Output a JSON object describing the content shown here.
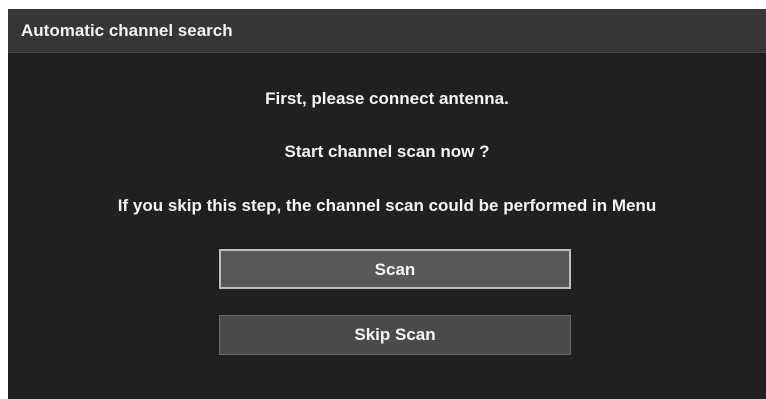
{
  "dialog": {
    "title": "Automatic channel search",
    "messages": [
      "First, please connect antenna.",
      "Start channel scan now ?",
      "If you skip this step, the channel scan could be performed in Menu"
    ],
    "buttons": {
      "scan_label": "Scan",
      "skip_label": "Skip Scan"
    }
  },
  "colors": {
    "dialog_background": "#202020",
    "titlebar_background": "#363636",
    "focused_button_background": "#585858",
    "button_background": "#4a4a4a",
    "text": "#f4f4f4"
  }
}
